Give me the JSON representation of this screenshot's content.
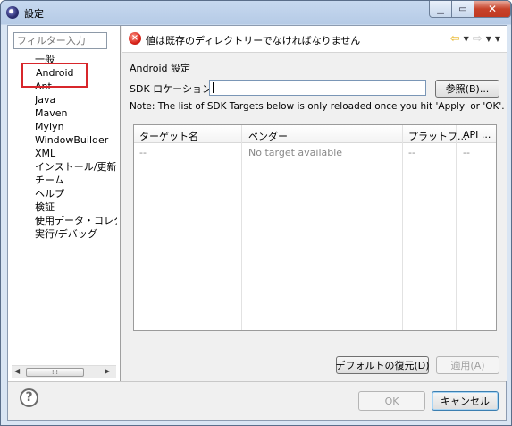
{
  "window": {
    "title": "設定"
  },
  "filter": {
    "placeholder": "フィルター入力"
  },
  "tree": {
    "items": [
      "一般",
      "Android",
      "Ant",
      "Java",
      "Maven",
      "Mylyn",
      "WindowBuilder",
      "XML",
      "インストール/更新",
      "チーム",
      "ヘルプ",
      "検証",
      "使用データ・コレクタ",
      "実行/デバッグ"
    ],
    "selected": "Android"
  },
  "header": {
    "error_message": "値は既存のディレクトリーでなければなりません",
    "error_icon": "error-icon",
    "back_icon": "back-arrow-icon",
    "forward_icon": "forward-arrow-icon"
  },
  "page": {
    "section_title": "Android 設定",
    "sdk_label": "SDK ロケーション:",
    "sdk_value": "",
    "browse_label": "参照(B)...",
    "note": "Note: The list of SDK Targets below is only reloaded once you hit 'Apply' or 'OK'."
  },
  "table": {
    "columns": [
      "ターゲット名",
      "ベンダー",
      "プラットフ...",
      "API ..."
    ],
    "rows": [
      [
        "--",
        "No target available",
        "--",
        "--"
      ]
    ]
  },
  "buttons": {
    "restore": "デフォルトの復元(D)",
    "apply": "適用(A)",
    "ok": "OK",
    "cancel": "キャンセル"
  },
  "colors": {
    "error": "#d8231a",
    "highlight": "#d8262b",
    "accent": "#3c7fb1"
  }
}
